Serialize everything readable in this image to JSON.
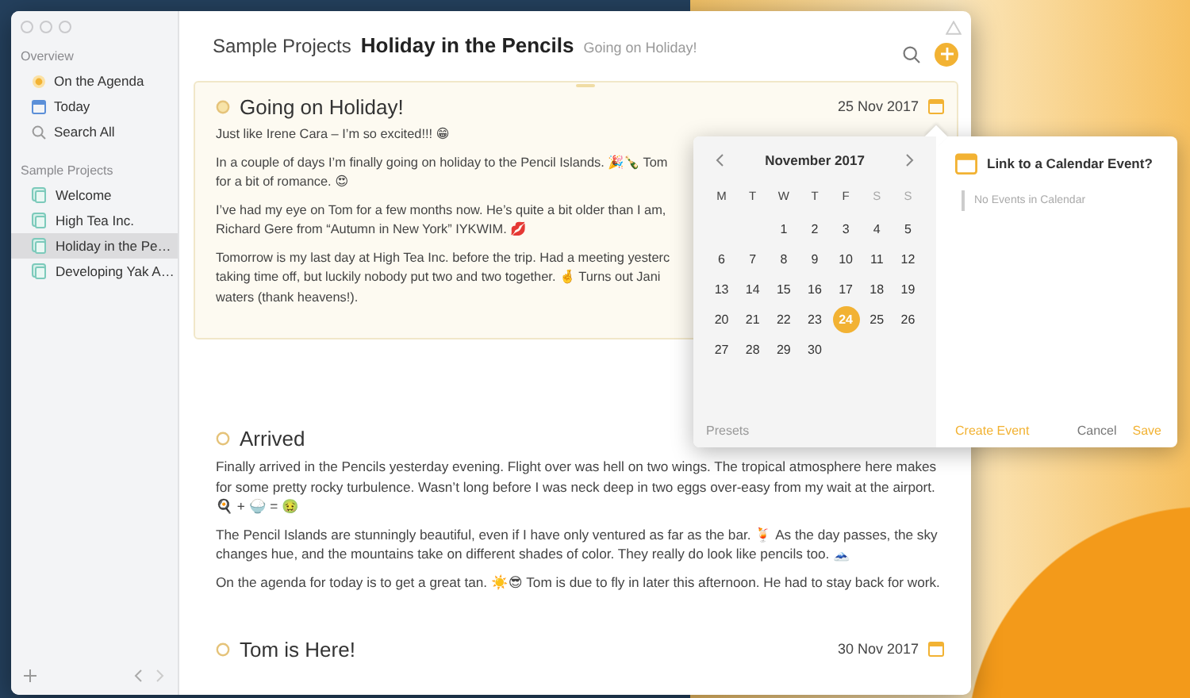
{
  "sidebar": {
    "sections": [
      {
        "title": "Overview",
        "items": [
          {
            "label": "On the Agenda",
            "kind": "agenda",
            "selected": false
          },
          {
            "label": "Today",
            "kind": "today",
            "selected": false
          },
          {
            "label": "Search All",
            "kind": "search",
            "selected": false
          }
        ]
      },
      {
        "title": "Sample Projects",
        "items": [
          {
            "label": "Welcome",
            "kind": "project",
            "selected": false
          },
          {
            "label": "High Tea Inc.",
            "kind": "project",
            "selected": false
          },
          {
            "label": "Holiday in the Pe…",
            "kind": "project",
            "selected": true
          },
          {
            "label": "Developing Yak A…",
            "kind": "project",
            "selected": false
          }
        ]
      }
    ]
  },
  "header": {
    "breadcrumb": "Sample Projects",
    "title": "Holiday in the Pencils",
    "subtitle": "Going on Holiday!"
  },
  "entries": [
    {
      "title": "Going on Holiday!",
      "date": "25 Nov 2017",
      "highlighted": true,
      "paragraphs": [
        {
          "lines": [
            "Just like Irene Cara – I’m so excited!!! 😁"
          ]
        },
        {
          "lines": [
            "In a couple of days I’m finally going on holiday to the Pencil Islands. 🎉🍾 Tom",
            "for a bit of romance. 😍"
          ]
        },
        {
          "lines": [
            "I’ve had my eye on Tom for a few months now. He’s quite a bit older than I am,",
            "Richard Gere from “Autumn in New York” IYKWIM. 💋"
          ]
        },
        {
          "lines": [
            "Tomorrow is my last day at High Tea Inc. before the trip. Had a meeting yesterc",
            "taking time off, but luckily nobody put two and two together. 🤞 Turns out Jani",
            "waters (thank heavens!)."
          ]
        }
      ]
    },
    {
      "title": "Arrived",
      "highlighted": false,
      "paragraphs": [
        {
          "lines": [
            "Finally arrived in the Pencils yesterday evening. Flight over was hell on two wings. The tropical atmosphere here makes for some pretty rocky turbulence. Wasn’t long before I was neck deep in two eggs over-easy from my wait at the airport.",
            "🍳 + 🍚 = 🤢"
          ]
        },
        {
          "lines": [
            "The Pencil Islands are stunningly beautiful, even if I have only ventured as far as the bar. 🍹 As the day passes, the sky changes hue, and the mountains take on different shades of color. They really do look like pencils too. 🗻"
          ]
        },
        {
          "lines": [
            "On the agenda for today is to get a great tan. ☀️😎 Tom is due to fly in later this afternoon. He had to stay back for work."
          ]
        }
      ]
    },
    {
      "title": "Tom is Here!",
      "date": "30 Nov 2017",
      "highlighted": false
    }
  ],
  "date_picker": {
    "month": "November 2017",
    "presets": "Presets",
    "weekdays": [
      {
        "label": "M",
        "weekend": false
      },
      {
        "label": "T",
        "weekend": false
      },
      {
        "label": "W",
        "weekend": false
      },
      {
        "label": "T",
        "weekend": false
      },
      {
        "label": "F",
        "weekend": false
      },
      {
        "label": "S",
        "weekend": true
      },
      {
        "label": "S",
        "weekend": true
      }
    ],
    "weeks": [
      [
        {
          "label": "1",
          "selected": false
        },
        {
          "label": "2",
          "selected": false
        },
        {
          "label": "3",
          "selected": false
        },
        {
          "label": "4",
          "selected": false
        },
        {
          "label": "5",
          "selected": false
        }
      ],
      [
        {
          "label": "6",
          "selected": false
        },
        {
          "label": "7",
          "selected": false
        },
        {
          "label": "8",
          "selected": false
        },
        {
          "label": "9",
          "selected": false
        },
        {
          "label": "10",
          "selected": false
        },
        {
          "label": "11",
          "selected": false
        },
        {
          "label": "12",
          "selected": false
        }
      ],
      [
        {
          "label": "13",
          "selected": false
        },
        {
          "label": "14",
          "selected": false
        },
        {
          "label": "15",
          "selected": false
        },
        {
          "label": "16",
          "selected": false
        },
        {
          "label": "17",
          "selected": false
        },
        {
          "label": "18",
          "selected": false
        },
        {
          "label": "19",
          "selected": false
        }
      ],
      [
        {
          "label": "20",
          "selected": false
        },
        {
          "label": "21",
          "selected": false
        },
        {
          "label": "22",
          "selected": false
        },
        {
          "label": "23",
          "selected": false
        },
        {
          "label": "24",
          "selected": true
        },
        {
          "label": "25",
          "selected": false
        },
        {
          "label": "26",
          "selected": false
        }
      ],
      [
        {
          "label": "27",
          "selected": false
        },
        {
          "label": "28",
          "selected": false
        },
        {
          "label": "29",
          "selected": false
        },
        {
          "label": "30",
          "selected": false
        }
      ]
    ]
  },
  "event_panel": {
    "title": "Link to a Calendar Event?",
    "empty_text": "No Events in Calendar",
    "buttons": [
      {
        "label": "Create Event",
        "kind": "accent"
      },
      {
        "label": "Cancel",
        "kind": "plain"
      },
      {
        "label": "Save",
        "kind": "accent"
      }
    ]
  }
}
